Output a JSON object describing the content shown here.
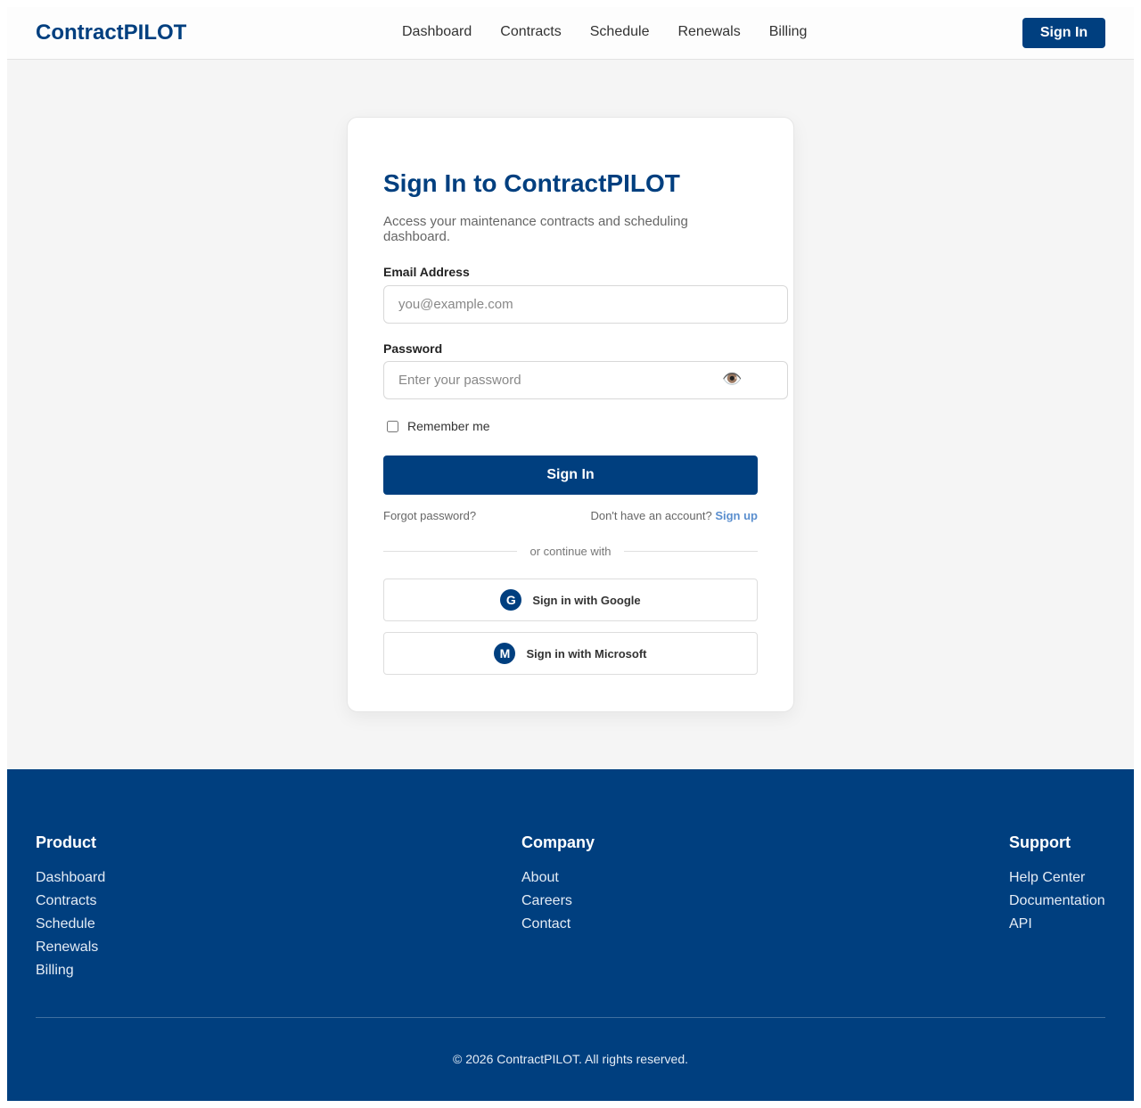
{
  "header": {
    "logo": "ContractPILOT",
    "nav": [
      "Dashboard",
      "Contracts",
      "Schedule",
      "Renewals",
      "Billing"
    ],
    "sign_in_label": "Sign In"
  },
  "card": {
    "title": "Sign In to ContractPILOT",
    "subtitle": "Access your maintenance contracts and scheduling dashboard.",
    "email_label": "Email Address",
    "email_placeholder": "you@example.com",
    "password_label": "Password",
    "password_placeholder": "Enter your password",
    "eye_icon": "👁️",
    "remember_label": "Remember me",
    "submit_label": "Sign In",
    "forgot_label": "Forgot password?",
    "no_account_text": "Don't have an account?",
    "signup_label": "Sign up",
    "divider_text": "or continue with",
    "google": {
      "badge": "G",
      "label": "Sign in with Google"
    },
    "microsoft": {
      "badge": "M",
      "label": "Sign in with Microsoft"
    }
  },
  "footer": {
    "product": {
      "heading": "Product",
      "links": [
        "Dashboard",
        "Contracts",
        "Schedule",
        "Renewals",
        "Billing"
      ]
    },
    "company": {
      "heading": "Company",
      "links": [
        "About",
        "Careers",
        "Contact"
      ]
    },
    "support": {
      "heading": "Support",
      "links": [
        "Help Center",
        "Documentation",
        "API"
      ]
    },
    "copyright": "© 2026 ContractPILOT. All rights reserved."
  },
  "colors": {
    "brand": "#003f7f",
    "link": "#5b8fcf",
    "background": "#f5f5f5"
  }
}
